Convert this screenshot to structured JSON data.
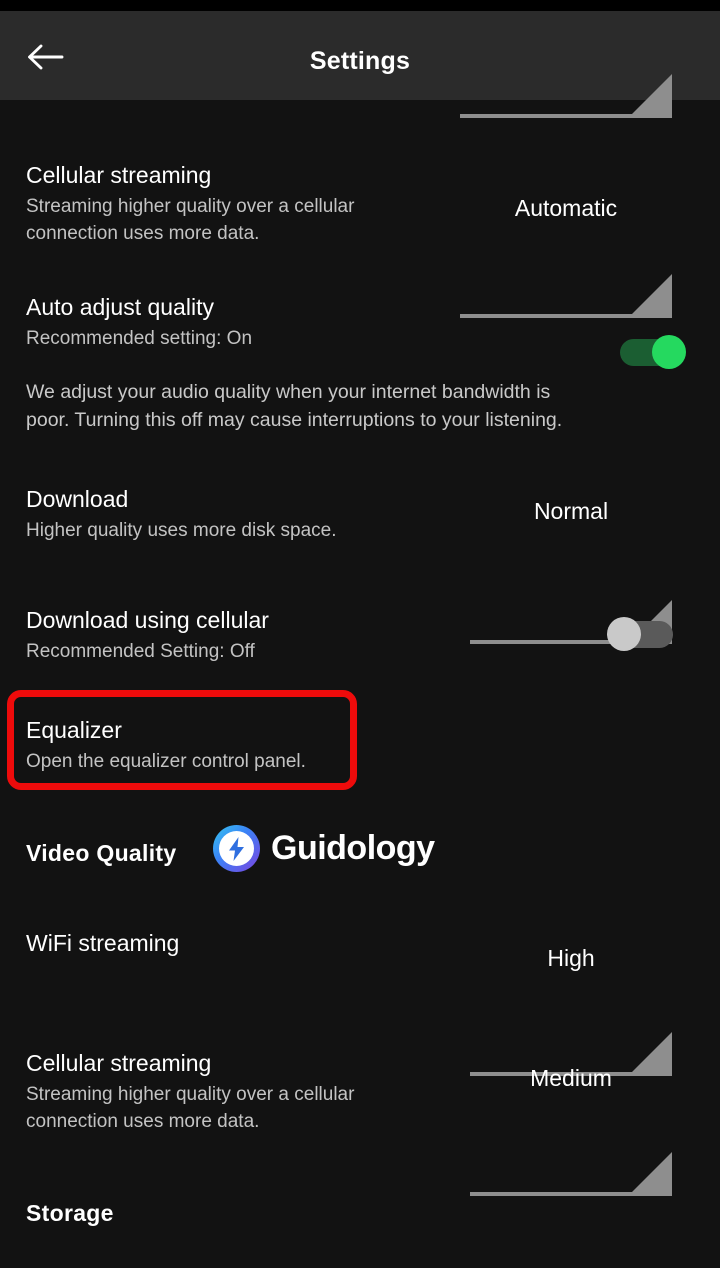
{
  "app": {
    "title": "Settings",
    "back_icon": "arrow-left-icon"
  },
  "colors": {
    "background": "#121212",
    "appbar": "#2b2b2b",
    "text_primary": "#ffffff",
    "text_secondary": "#c3c3c3",
    "toggle_on_thumb": "#25d95f",
    "toggle_on_track": "#1b5e32",
    "toggle_off_thumb": "#c9c9c9",
    "toggle_off_track": "#5a5a5a",
    "spinner_line": "#8e8e8e",
    "annotation": "#ee0b0b"
  },
  "partial_row_top": {
    "spinner_value": ""
  },
  "rows": {
    "cellular_streaming_audio": {
      "title": "Cellular streaming",
      "subtitle_line1": "Streaming higher quality over a cellular",
      "subtitle_line2": "connection uses more data.",
      "spinner_value": "Automatic"
    },
    "auto_adjust_quality": {
      "title": "Auto adjust quality",
      "subtitle": "Recommended setting: On",
      "toggle_state": "on",
      "note_line1": "We adjust your audio quality when your internet bandwidth is",
      "note_line2": "poor. Turning this off may cause interruptions to your listening."
    },
    "download": {
      "title": "Download",
      "subtitle": "Higher quality uses more disk space.",
      "spinner_value": "Normal"
    },
    "download_using_cellular": {
      "title": "Download using cellular",
      "subtitle": "Recommended Setting: Off",
      "toggle_state": "off"
    },
    "equalizer": {
      "title": "Equalizer",
      "subtitle": "Open the equalizer control panel."
    },
    "video_quality_header": {
      "title": "Video Quality"
    },
    "wifi_streaming": {
      "title": "WiFi streaming",
      "spinner_value": "High"
    },
    "cellular_streaming_video": {
      "title": "Cellular streaming",
      "subtitle_line1": "Streaming higher quality over a cellular",
      "subtitle_line2": "connection uses more data.",
      "spinner_value": "Medium"
    },
    "storage_header": {
      "title": "Storage"
    }
  },
  "watermark": {
    "brand": "Guidology",
    "logo_icon": "lightning-bolt-circle-icon"
  }
}
